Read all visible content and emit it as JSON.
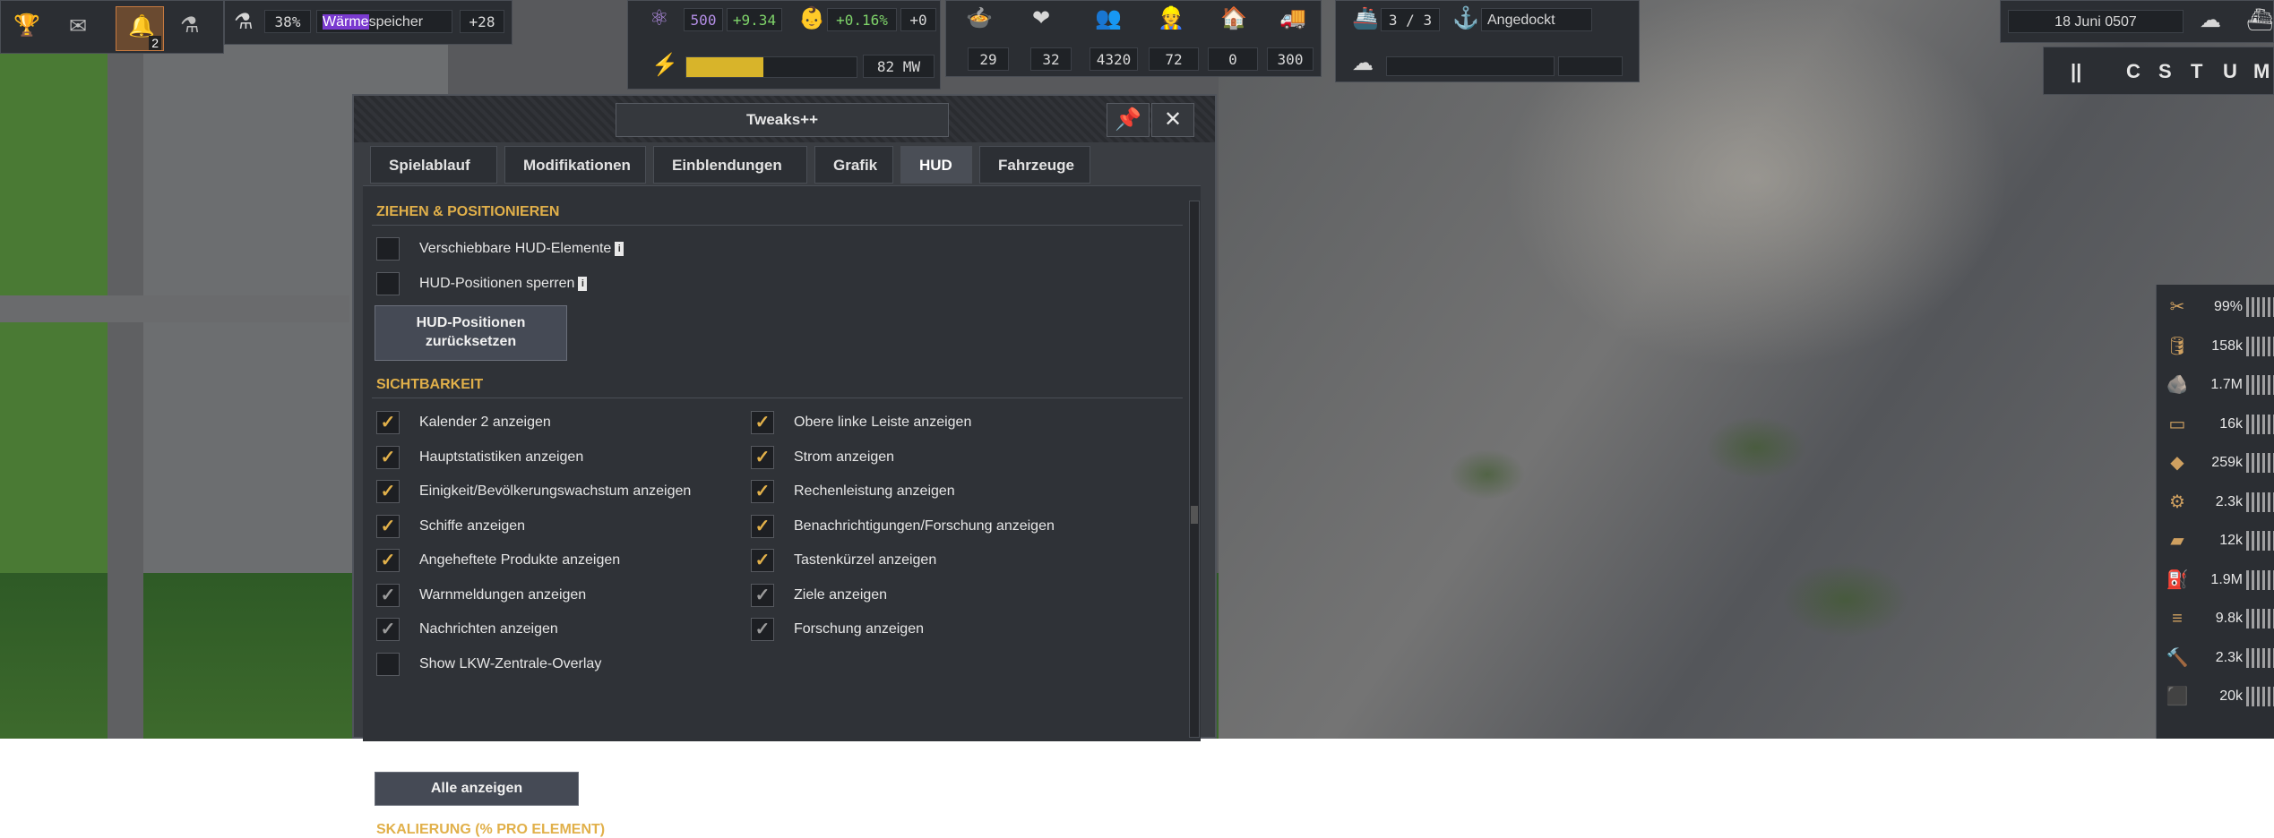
{
  "top_left": {
    "notifications_badge": "2",
    "research_percent": "38%",
    "research_name_highlight": "Wärme",
    "research_name_rest": "speicher",
    "research_extra": "+28"
  },
  "top_center": {
    "unity_value": "500",
    "unity_delta": "+9.34",
    "pop_growth": "+0.16%",
    "pop_extra": "+0",
    "power_value": "82 MW",
    "power_fill": 0.45
  },
  "stats": {
    "food": "29",
    "health": "32",
    "population": "4320",
    "workers": "72",
    "housing": "0",
    "vehicles": "300"
  },
  "ships": {
    "count": "3 / 3",
    "status": "Angedockt"
  },
  "date": "18 Juni 0507",
  "shortcuts": [
    "||",
    "C",
    "S",
    "T",
    "U",
    "M"
  ],
  "dialog": {
    "title": "Tweaks++",
    "pin_icon": "pin-icon",
    "close_icon": "close-icon",
    "tabs": [
      "Spielablauf",
      "Modifikationen",
      "Einblendungen",
      "Grafik",
      "HUD",
      "Fahrzeuge"
    ],
    "active_tab": "HUD",
    "section_drag": "ZIEHEN & POSITIONIEREN",
    "drag_options": [
      {
        "label": "Verschiebbare HUD-Elemente",
        "info": "i",
        "checked": false
      },
      {
        "label": "HUD-Positionen sperren",
        "info": "i",
        "checked": false
      }
    ],
    "reset_button": "HUD-Positionen zurücksetzen",
    "reset_button_line1": "HUD-Positionen",
    "reset_button_line2": "zurücksetzen",
    "section_visibility": "SICHTBARKEIT",
    "left_options": [
      {
        "label": "Kalender 2 anzeigen",
        "checked": "yes"
      },
      {
        "label": "Hauptstatistiken anzeigen",
        "checked": "yes"
      },
      {
        "label": "Einigkeit/Bevölkerungswachstum anzeigen",
        "checked": "yes"
      },
      {
        "label": "Schiffe anzeigen",
        "checked": "yes"
      },
      {
        "label": "Angeheftete Produkte anzeigen",
        "checked": "yes"
      },
      {
        "label": "Warnmeldungen anzeigen",
        "checked": "dim"
      },
      {
        "label": "Nachrichten anzeigen",
        "checked": "dim"
      },
      {
        "label": "Show LKW-Zentrale-Overlay",
        "checked": "no"
      }
    ],
    "right_options": [
      {
        "label": "Obere linke Leiste anzeigen",
        "checked": "yes"
      },
      {
        "label": "Strom anzeigen",
        "checked": "yes"
      },
      {
        "label": "Rechenleistung anzeigen",
        "checked": "yes"
      },
      {
        "label": "Benachrichtigungen/Forschung anzeigen",
        "checked": "yes"
      },
      {
        "label": "Tastenkürzel anzeigen",
        "checked": "yes"
      },
      {
        "label": "Ziele anzeigen",
        "checked": "dim"
      },
      {
        "label": "Forschung anzeigen",
        "checked": "dim"
      }
    ],
    "show_all_button": "Alle anzeigen",
    "section_scaling": "SKALIERUNG (% PRO ELEMENT)"
  },
  "resources": [
    {
      "icon": "tools-icon",
      "value": "99%"
    },
    {
      "icon": "barrel-icon",
      "value": "158k"
    },
    {
      "icon": "rock-icon",
      "value": "1.7M"
    },
    {
      "icon": "plate-icon",
      "value": "16k"
    },
    {
      "icon": "ore-icon",
      "value": "259k"
    },
    {
      "icon": "worker-icon",
      "value": "2.3k"
    },
    {
      "icon": "wood-icon",
      "value": "12k"
    },
    {
      "icon": "fuel-icon",
      "value": "1.9M"
    },
    {
      "icon": "steel-icon",
      "value": "9.8k"
    },
    {
      "icon": "hammer-icon",
      "value": "2.3k"
    },
    {
      "icon": "concrete-icon",
      "value": "20k"
    }
  ]
}
